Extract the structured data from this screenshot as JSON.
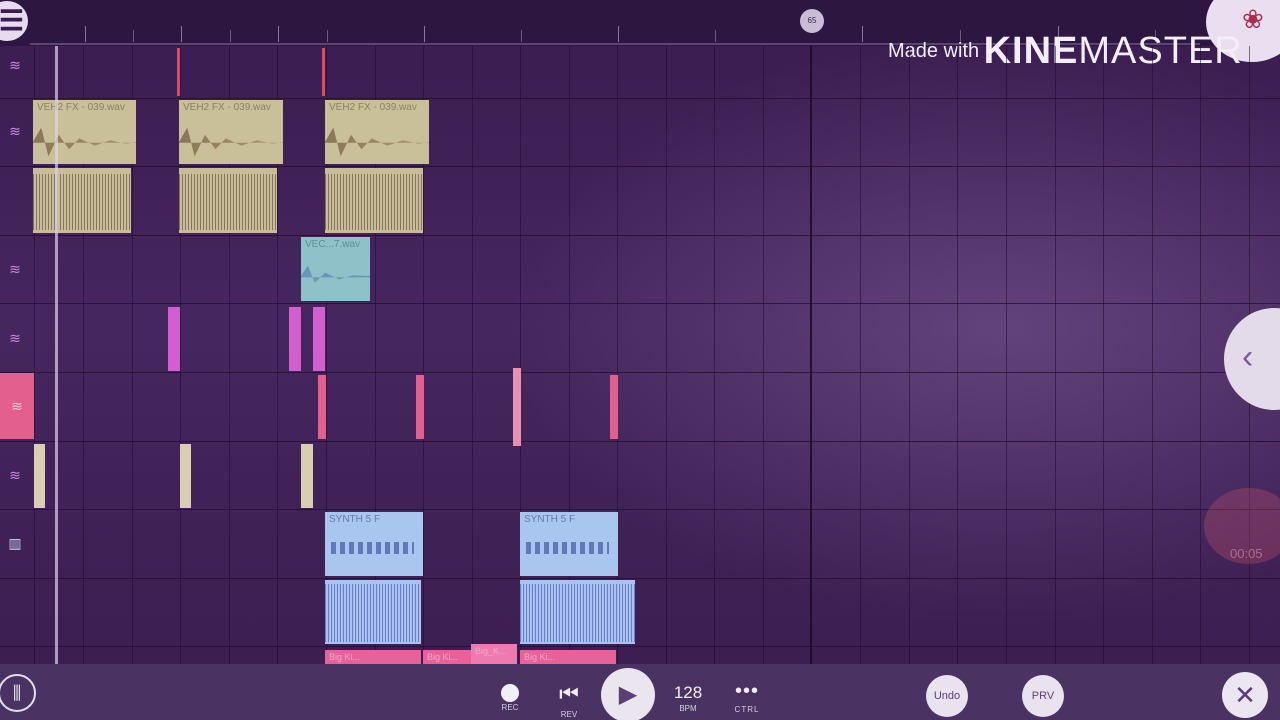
{
  "watermark": {
    "made_with": "Made with",
    "brand_bold": "KINE",
    "brand_rest": "MASTER"
  },
  "ruler": {
    "marker_label": "65"
  },
  "menu_icon": "menu-icon",
  "clips": {
    "veh_fx_label": "VEH2 FX - 039.wav",
    "vec_label": "VEC...7.wav",
    "synth_label": "SYNTH 5 F",
    "kick_label": "Big Ki...",
    "kick_label_short": "Big_K..."
  },
  "side": {
    "timer": "00:05"
  },
  "transport": {
    "rec_label": "REC",
    "rev_label": "REV",
    "bpm_value": "128",
    "bpm_label": "BPM",
    "ctrl_glyph": "•••",
    "ctrl_label": "CTRL",
    "undo_label": "Undo",
    "prv_label": "PRV",
    "close_glyph": "✕"
  },
  "colors": {
    "accent_pink": "#e2608e",
    "magenta": "#d35ecf",
    "sand": "#c9bf98",
    "teal": "#8fc2c8",
    "blue": "#a8c6ee"
  }
}
